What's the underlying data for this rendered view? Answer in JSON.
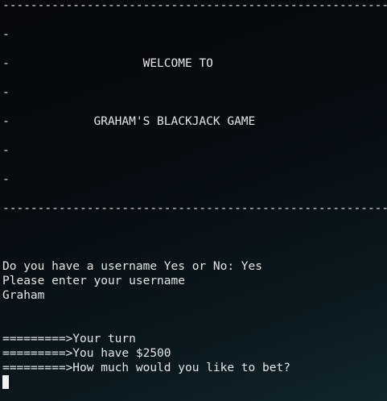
{
  "banner": {
    "border": "----------------------------------------------------------",
    "blank_row": "-                                                       -",
    "welcome_row": "-                   WELCOME TO                          -",
    "title_row": "-            GRAHAM'S BLACKJACK GAME                    -"
  },
  "session": {
    "username_prompt": "Do you have a username Yes or No: Yes",
    "enter_username": "Please enter your username",
    "username_value": "Graham",
    "turn_line": "=========>Your turn",
    "balance_line": "=========>You have $2500",
    "bet_prompt": "=========>How much would you like to bet?"
  },
  "colors": {
    "text": "#e6e6e6",
    "background": "#070d12",
    "cursor": "#f2f2f2"
  }
}
